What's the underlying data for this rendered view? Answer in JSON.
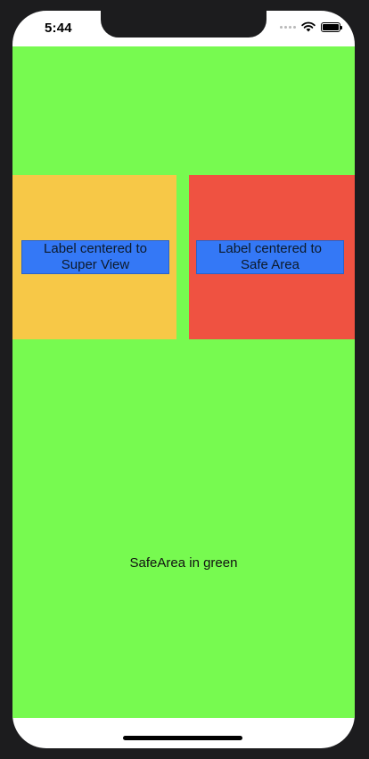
{
  "status_bar": {
    "time": "5:44",
    "battery_level": 1.0
  },
  "safe_area": {
    "background_color": "#77fa50",
    "caption": "SafeArea in green"
  },
  "super_view_box": {
    "background_color": "#f7c847",
    "label_line1": "Label centered to",
    "label_line2": "Super View"
  },
  "safe_area_box": {
    "background_color": "#ef5241",
    "label_line1": "Label centered to",
    "label_line2": "Safe Area"
  },
  "label_color": "#3478f6"
}
